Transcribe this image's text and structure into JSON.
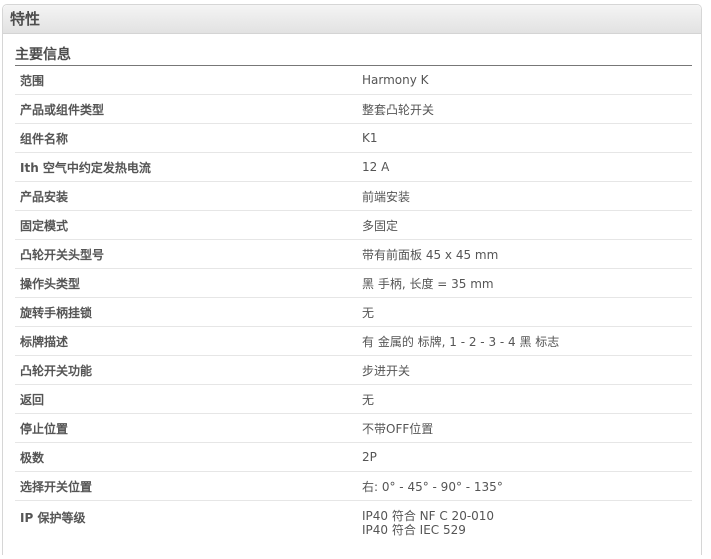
{
  "panel": {
    "title": "特性"
  },
  "section": {
    "title": "主要信息"
  },
  "rows": [
    {
      "label": "范围",
      "value": "Harmony K"
    },
    {
      "label": "产品或组件类型",
      "value": "整套凸轮开关"
    },
    {
      "label": "组件名称",
      "value": "K1"
    },
    {
      "label": "Ith 空气中约定发热电流",
      "value": "12 A"
    },
    {
      "label": "产品安装",
      "value": "前端安装"
    },
    {
      "label": "固定模式",
      "value": "多固定"
    },
    {
      "label": "凸轮开关头型号",
      "value": "带有前面板 45 x 45 mm"
    },
    {
      "label": "操作头类型",
      "value": "黑 手柄, 长度 = 35 mm"
    },
    {
      "label": "旋转手柄挂锁",
      "value": "无"
    },
    {
      "label": "标牌描述",
      "value": "有 金属的 标牌, 1 - 2 - 3 - 4 黑 标志"
    },
    {
      "label": "凸轮开关功能",
      "value": "步进开关"
    },
    {
      "label": "返回",
      "value": "无"
    },
    {
      "label": "停止位置",
      "value": "不带OFF位置"
    },
    {
      "label": "极数",
      "value": "2P"
    },
    {
      "label": "选择开关位置",
      "value": "右: 0° - 45° - 90° - 135°"
    },
    {
      "label": "IP 保护等级",
      "values": [
        "IP40 符合 NF C 20-010",
        "IP40 符合 IEC 529"
      ]
    }
  ]
}
